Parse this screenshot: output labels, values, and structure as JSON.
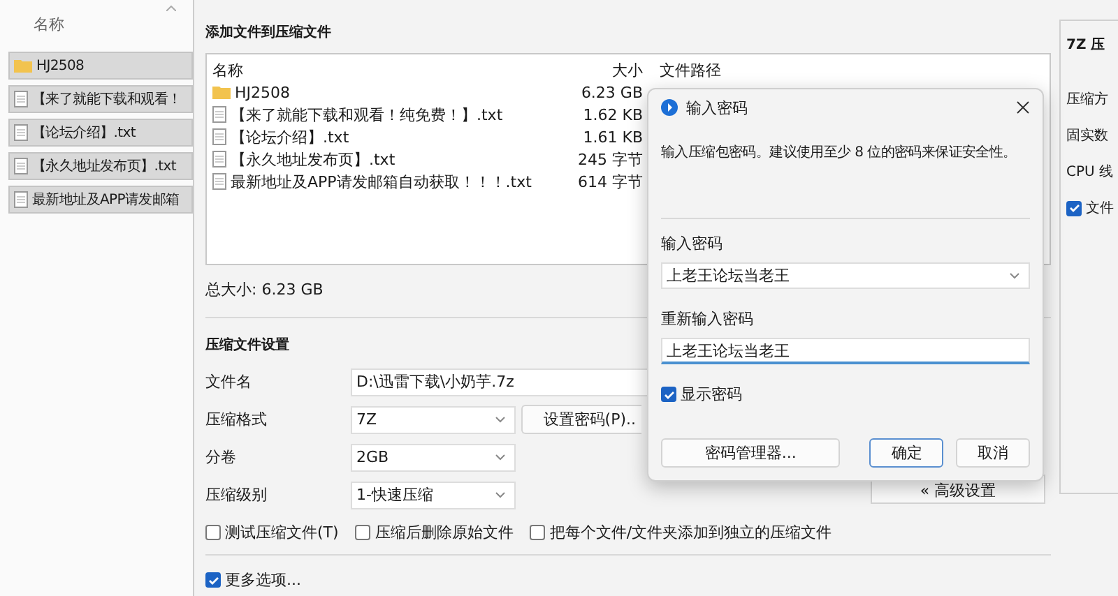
{
  "explorer": {
    "column": "名称",
    "items": [
      {
        "name": "HJ2508",
        "kind": "folder"
      },
      {
        "name": "【来了就能下载和观看！",
        "kind": "file"
      },
      {
        "name": "【论坛介绍】.txt",
        "kind": "file"
      },
      {
        "name": "【永久地址发布页】.txt",
        "kind": "file"
      },
      {
        "name": "最新地址及APP请发邮箱",
        "kind": "file"
      }
    ]
  },
  "main": {
    "title": "添加文件到压缩文件",
    "files": {
      "columns": [
        "名称",
        "大小",
        "文件路径"
      ],
      "rows": [
        {
          "name": "HJ2508",
          "size": "6.23 GB",
          "kind": "folder"
        },
        {
          "name": "【来了就能下载和观看！纯免费！】.txt",
          "size": "1.62 KB",
          "kind": "file"
        },
        {
          "name": "【论坛介绍】.txt",
          "size": "1.61 KB",
          "kind": "file"
        },
        {
          "name": "【永久地址发布页】.txt",
          "size": "245 字节",
          "kind": "file"
        },
        {
          "name": "最新地址及APP请发邮箱自动获取！！！.txt",
          "size": "614 字节",
          "kind": "file"
        }
      ]
    },
    "total": "总大小: 6.23 GB",
    "settings_title": "压缩文件设置",
    "fields": [
      {
        "label": "文件名",
        "value": "D:\\迅雷下载\\小奶芋.7z",
        "kind": "text"
      },
      {
        "label": "压缩格式",
        "value": "7Z",
        "kind": "select"
      },
      {
        "label": "分卷",
        "value": "2GB",
        "kind": "select"
      },
      {
        "label": "压缩级别",
        "value": "1-快速压缩",
        "kind": "select"
      }
    ],
    "password_button": "设置密码(P)..",
    "options": [
      {
        "label": "测试压缩文件(T)",
        "checked": false
      },
      {
        "label": "压缩后删除原始文件",
        "checked": false
      },
      {
        "label": "把每个文件/文件夹添加到独立的压缩文件",
        "checked": false
      }
    ],
    "more": {
      "label": "更多选项...",
      "checked": true
    },
    "advanced_button": "« 高级设置"
  },
  "side": {
    "title": "7Z 压",
    "labels": [
      "压缩方",
      "固实数",
      "CPU 线"
    ],
    "option": {
      "label": "文件",
      "checked": true
    }
  },
  "dialog": {
    "title": "输入密码",
    "message": "输入压缩包密码。建议使用至少 8 位的密码来保证安全性。",
    "password": {
      "label": "输入密码",
      "value": "上老王论坛当老王"
    },
    "confirm": {
      "label": "重新输入密码",
      "value": "上老王论坛当老王"
    },
    "show": {
      "label": "显示密码",
      "checked": true
    },
    "buttons": [
      {
        "label": "密码管理器...",
        "default": false
      },
      {
        "label": "确定",
        "default": true
      },
      {
        "label": "取消",
        "default": false
      }
    ]
  }
}
